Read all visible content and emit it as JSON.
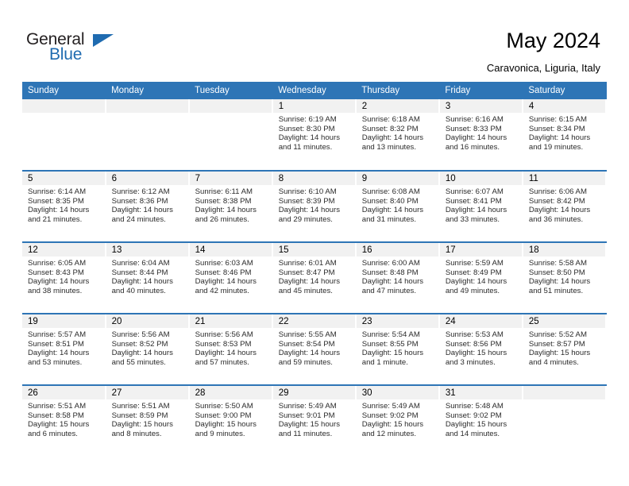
{
  "brand": {
    "name_top": "General",
    "name_bottom": "Blue",
    "color_top": "#231f20",
    "color_bottom": "#1f6bb0",
    "triangle_icon": "triangle-icon"
  },
  "header": {
    "title": "May 2024",
    "subtitle": "Caravonica, Liguria, Italy"
  },
  "theme": {
    "header_blue": "#2e75b6",
    "daynum_bg": "#f1f1f1",
    "text": "#000000"
  },
  "calendar": {
    "weekday_headers": [
      "Sunday",
      "Monday",
      "Tuesday",
      "Wednesday",
      "Thursday",
      "Friday",
      "Saturday"
    ],
    "weeks": [
      [
        {
          "day": "",
          "sunrise": "",
          "sunset": "",
          "daylight_line1": "",
          "daylight_line2": ""
        },
        {
          "day": "",
          "sunrise": "",
          "sunset": "",
          "daylight_line1": "",
          "daylight_line2": ""
        },
        {
          "day": "",
          "sunrise": "",
          "sunset": "",
          "daylight_line1": "",
          "daylight_line2": ""
        },
        {
          "day": "1",
          "sunrise": "Sunrise: 6:19 AM",
          "sunset": "Sunset: 8:30 PM",
          "daylight_line1": "Daylight: 14 hours",
          "daylight_line2": "and 11 minutes."
        },
        {
          "day": "2",
          "sunrise": "Sunrise: 6:18 AM",
          "sunset": "Sunset: 8:32 PM",
          "daylight_line1": "Daylight: 14 hours",
          "daylight_line2": "and 13 minutes."
        },
        {
          "day": "3",
          "sunrise": "Sunrise: 6:16 AM",
          "sunset": "Sunset: 8:33 PM",
          "daylight_line1": "Daylight: 14 hours",
          "daylight_line2": "and 16 minutes."
        },
        {
          "day": "4",
          "sunrise": "Sunrise: 6:15 AM",
          "sunset": "Sunset: 8:34 PM",
          "daylight_line1": "Daylight: 14 hours",
          "daylight_line2": "and 19 minutes."
        }
      ],
      [
        {
          "day": "5",
          "sunrise": "Sunrise: 6:14 AM",
          "sunset": "Sunset: 8:35 PM",
          "daylight_line1": "Daylight: 14 hours",
          "daylight_line2": "and 21 minutes."
        },
        {
          "day": "6",
          "sunrise": "Sunrise: 6:12 AM",
          "sunset": "Sunset: 8:36 PM",
          "daylight_line1": "Daylight: 14 hours",
          "daylight_line2": "and 24 minutes."
        },
        {
          "day": "7",
          "sunrise": "Sunrise: 6:11 AM",
          "sunset": "Sunset: 8:38 PM",
          "daylight_line1": "Daylight: 14 hours",
          "daylight_line2": "and 26 minutes."
        },
        {
          "day": "8",
          "sunrise": "Sunrise: 6:10 AM",
          "sunset": "Sunset: 8:39 PM",
          "daylight_line1": "Daylight: 14 hours",
          "daylight_line2": "and 29 minutes."
        },
        {
          "day": "9",
          "sunrise": "Sunrise: 6:08 AM",
          "sunset": "Sunset: 8:40 PM",
          "daylight_line1": "Daylight: 14 hours",
          "daylight_line2": "and 31 minutes."
        },
        {
          "day": "10",
          "sunrise": "Sunrise: 6:07 AM",
          "sunset": "Sunset: 8:41 PM",
          "daylight_line1": "Daylight: 14 hours",
          "daylight_line2": "and 33 minutes."
        },
        {
          "day": "11",
          "sunrise": "Sunrise: 6:06 AM",
          "sunset": "Sunset: 8:42 PM",
          "daylight_line1": "Daylight: 14 hours",
          "daylight_line2": "and 36 minutes."
        }
      ],
      [
        {
          "day": "12",
          "sunrise": "Sunrise: 6:05 AM",
          "sunset": "Sunset: 8:43 PM",
          "daylight_line1": "Daylight: 14 hours",
          "daylight_line2": "and 38 minutes."
        },
        {
          "day": "13",
          "sunrise": "Sunrise: 6:04 AM",
          "sunset": "Sunset: 8:44 PM",
          "daylight_line1": "Daylight: 14 hours",
          "daylight_line2": "and 40 minutes."
        },
        {
          "day": "14",
          "sunrise": "Sunrise: 6:03 AM",
          "sunset": "Sunset: 8:46 PM",
          "daylight_line1": "Daylight: 14 hours",
          "daylight_line2": "and 42 minutes."
        },
        {
          "day": "15",
          "sunrise": "Sunrise: 6:01 AM",
          "sunset": "Sunset: 8:47 PM",
          "daylight_line1": "Daylight: 14 hours",
          "daylight_line2": "and 45 minutes."
        },
        {
          "day": "16",
          "sunrise": "Sunrise: 6:00 AM",
          "sunset": "Sunset: 8:48 PM",
          "daylight_line1": "Daylight: 14 hours",
          "daylight_line2": "and 47 minutes."
        },
        {
          "day": "17",
          "sunrise": "Sunrise: 5:59 AM",
          "sunset": "Sunset: 8:49 PM",
          "daylight_line1": "Daylight: 14 hours",
          "daylight_line2": "and 49 minutes."
        },
        {
          "day": "18",
          "sunrise": "Sunrise: 5:58 AM",
          "sunset": "Sunset: 8:50 PM",
          "daylight_line1": "Daylight: 14 hours",
          "daylight_line2": "and 51 minutes."
        }
      ],
      [
        {
          "day": "19",
          "sunrise": "Sunrise: 5:57 AM",
          "sunset": "Sunset: 8:51 PM",
          "daylight_line1": "Daylight: 14 hours",
          "daylight_line2": "and 53 minutes."
        },
        {
          "day": "20",
          "sunrise": "Sunrise: 5:56 AM",
          "sunset": "Sunset: 8:52 PM",
          "daylight_line1": "Daylight: 14 hours",
          "daylight_line2": "and 55 minutes."
        },
        {
          "day": "21",
          "sunrise": "Sunrise: 5:56 AM",
          "sunset": "Sunset: 8:53 PM",
          "daylight_line1": "Daylight: 14 hours",
          "daylight_line2": "and 57 minutes."
        },
        {
          "day": "22",
          "sunrise": "Sunrise: 5:55 AM",
          "sunset": "Sunset: 8:54 PM",
          "daylight_line1": "Daylight: 14 hours",
          "daylight_line2": "and 59 minutes."
        },
        {
          "day": "23",
          "sunrise": "Sunrise: 5:54 AM",
          "sunset": "Sunset: 8:55 PM",
          "daylight_line1": "Daylight: 15 hours",
          "daylight_line2": "and 1 minute."
        },
        {
          "day": "24",
          "sunrise": "Sunrise: 5:53 AM",
          "sunset": "Sunset: 8:56 PM",
          "daylight_line1": "Daylight: 15 hours",
          "daylight_line2": "and 3 minutes."
        },
        {
          "day": "25",
          "sunrise": "Sunrise: 5:52 AM",
          "sunset": "Sunset: 8:57 PM",
          "daylight_line1": "Daylight: 15 hours",
          "daylight_line2": "and 4 minutes."
        }
      ],
      [
        {
          "day": "26",
          "sunrise": "Sunrise: 5:51 AM",
          "sunset": "Sunset: 8:58 PM",
          "daylight_line1": "Daylight: 15 hours",
          "daylight_line2": "and 6 minutes."
        },
        {
          "day": "27",
          "sunrise": "Sunrise: 5:51 AM",
          "sunset": "Sunset: 8:59 PM",
          "daylight_line1": "Daylight: 15 hours",
          "daylight_line2": "and 8 minutes."
        },
        {
          "day": "28",
          "sunrise": "Sunrise: 5:50 AM",
          "sunset": "Sunset: 9:00 PM",
          "daylight_line1": "Daylight: 15 hours",
          "daylight_line2": "and 9 minutes."
        },
        {
          "day": "29",
          "sunrise": "Sunrise: 5:49 AM",
          "sunset": "Sunset: 9:01 PM",
          "daylight_line1": "Daylight: 15 hours",
          "daylight_line2": "and 11 minutes."
        },
        {
          "day": "30",
          "sunrise": "Sunrise: 5:49 AM",
          "sunset": "Sunset: 9:02 PM",
          "daylight_line1": "Daylight: 15 hours",
          "daylight_line2": "and 12 minutes."
        },
        {
          "day": "31",
          "sunrise": "Sunrise: 5:48 AM",
          "sunset": "Sunset: 9:02 PM",
          "daylight_line1": "Daylight: 15 hours",
          "daylight_line2": "and 14 minutes."
        },
        {
          "day": "",
          "sunrise": "",
          "sunset": "",
          "daylight_line1": "",
          "daylight_line2": ""
        }
      ]
    ]
  }
}
